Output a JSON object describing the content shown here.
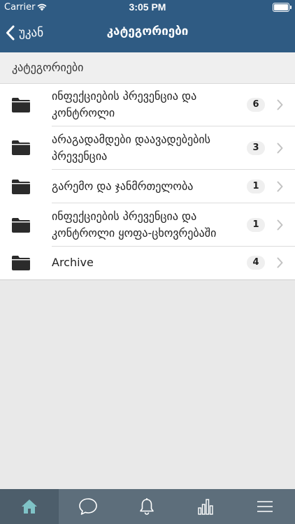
{
  "status_bar": {
    "carrier": "Carrier",
    "time": "3:05 PM"
  },
  "nav": {
    "back_label": "უკან",
    "title": "კატეგორიები"
  },
  "section": {
    "header": "კატეგორიები"
  },
  "categories": [
    {
      "line1": "ინფექციების პრევენცია და",
      "line2": "კონტროლი",
      "count": "6"
    },
    {
      "line1": "არაგადამდები დაავადებების",
      "line2": "პრევენცია",
      "count": "3"
    },
    {
      "line1": "გარემო და ჯანმრთელობა",
      "line2": "",
      "count": "1"
    },
    {
      "line1": "ინფექციების პრევენცია და",
      "line2": "კონტროლი ყოფა-ცხოვრებაში",
      "count": "1"
    },
    {
      "line1": "Archive",
      "line2": "",
      "count": "4"
    }
  ],
  "tabbar": {
    "tabs": [
      {
        "icon": "home-icon",
        "active": true
      },
      {
        "icon": "chat-icon",
        "active": false
      },
      {
        "icon": "bell-icon",
        "active": false
      },
      {
        "icon": "bar-chart-icon",
        "active": false
      },
      {
        "icon": "menu-icon",
        "active": false
      }
    ]
  },
  "colors": {
    "nav": "#2f5b83",
    "tabbar": "#5d6e7b",
    "icon_active": "#7fc3c7",
    "icon": "#ffffff"
  }
}
